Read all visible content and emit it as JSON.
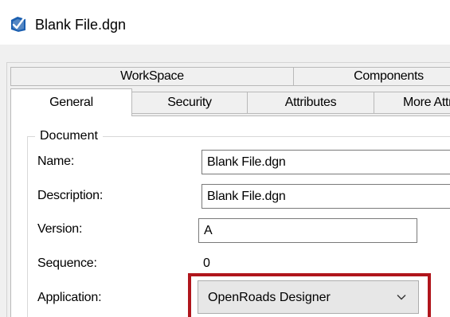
{
  "window": {
    "title": "Blank File.dgn",
    "app_icon": "bentley-file-icon"
  },
  "tabs_row1": [
    {
      "label": "WorkSpace"
    },
    {
      "label": "Components"
    }
  ],
  "tabs_row2": [
    {
      "label": "General",
      "selected": true
    },
    {
      "label": "Security"
    },
    {
      "label": "Attributes"
    },
    {
      "label": "More Attributes"
    }
  ],
  "document": {
    "legend": "Document",
    "name": {
      "label": "Name:",
      "value": "Blank File.dgn"
    },
    "description": {
      "label": "Description:",
      "value": "Blank File.dgn"
    },
    "version": {
      "label": "Version:",
      "value": "A"
    },
    "sequence": {
      "label": "Sequence:",
      "value": "0"
    },
    "application": {
      "label": "Application:",
      "value": "OpenRoads Designer",
      "icon": "chevron-down-icon"
    }
  },
  "colors": {
    "highlight": "#b0151c",
    "icon_blue": "#1b5fb0"
  }
}
